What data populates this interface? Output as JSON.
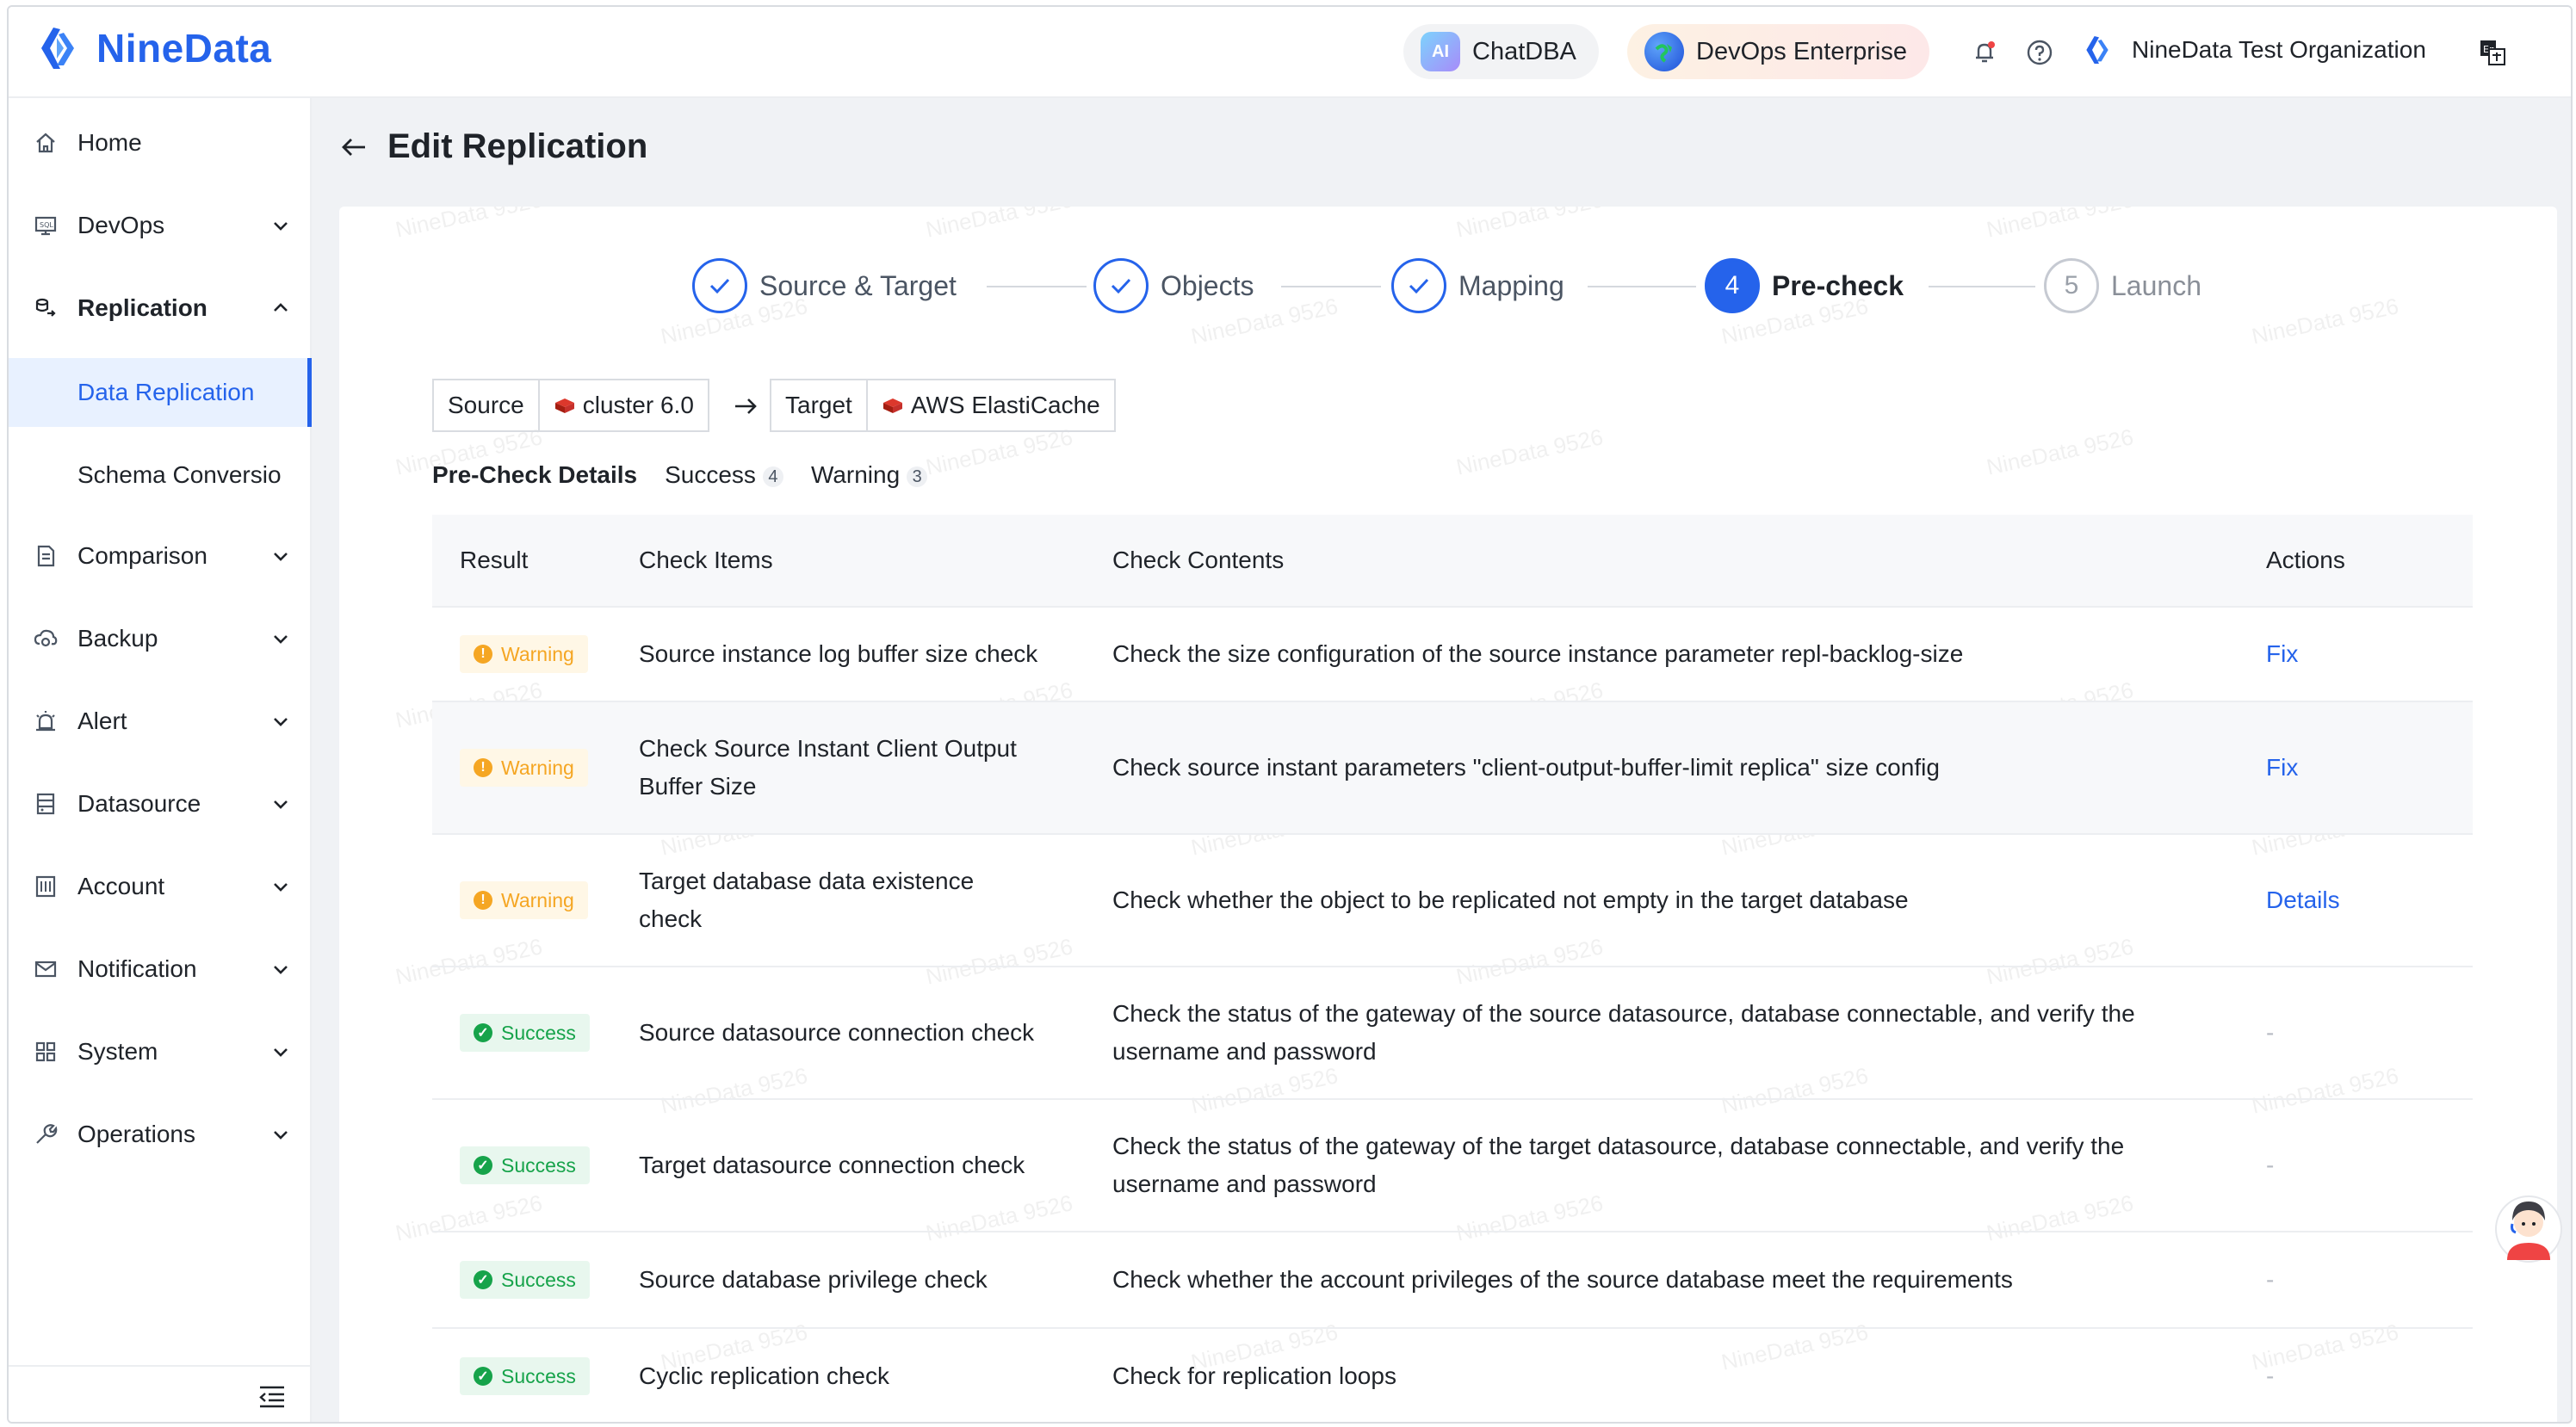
{
  "app": {
    "name": "NineData"
  },
  "header": {
    "chatdba_label": "ChatDBA",
    "chatdba_icon_text": "AI",
    "devops_label": "DevOps Enterprise",
    "org_name": "NineData Test Organization"
  },
  "sidebar": {
    "items": [
      {
        "label": "Home",
        "icon": "home-icon"
      },
      {
        "label": "DevOps",
        "icon": "devops-icon"
      },
      {
        "label": "Replication",
        "icon": "replication-icon"
      },
      {
        "label": "Data Replication"
      },
      {
        "label": "Schema Conversio"
      },
      {
        "label": "Comparison",
        "icon": "comparison-icon"
      },
      {
        "label": "Backup",
        "icon": "backup-icon"
      },
      {
        "label": "Alert",
        "icon": "alert-icon"
      },
      {
        "label": "Datasource",
        "icon": "datasource-icon"
      },
      {
        "label": "Account",
        "icon": "account-icon"
      },
      {
        "label": "Notification",
        "icon": "notification-icon"
      },
      {
        "label": "System",
        "icon": "system-icon"
      },
      {
        "label": "Operations",
        "icon": "operations-icon"
      }
    ]
  },
  "page": {
    "title": "Edit Replication"
  },
  "steps": [
    {
      "label": "Source & Target",
      "state": "done"
    },
    {
      "label": "Objects",
      "state": "done"
    },
    {
      "label": "Mapping",
      "state": "done"
    },
    {
      "label": "Pre-check",
      "number": "4",
      "state": "active"
    },
    {
      "label": "Launch",
      "number": "5",
      "state": "pending"
    }
  ],
  "source_target": {
    "source_label": "Source",
    "source_value": "cluster 6.0",
    "target_label": "Target",
    "target_value": "AWS ElastiCache"
  },
  "tabs": {
    "details": "Pre-Check Details",
    "success": "Success",
    "success_count": "4",
    "warning": "Warning",
    "warning_count": "3"
  },
  "table": {
    "headers": [
      "Result",
      "Check Items",
      "Check Contents",
      "Actions"
    ],
    "rows": [
      {
        "result": "Warning",
        "item": "Source instance log buffer size check",
        "content": "Check the size configuration of the source instance parameter repl-backlog-size",
        "action": "Fix"
      },
      {
        "result": "Warning",
        "item": "Check Source Instant Client Output Buffer Size",
        "content": "Check source instant parameters \"client-output-buffer-limit replica\" size config",
        "action": "Fix"
      },
      {
        "result": "Warning",
        "item": "Target database data existence check",
        "content": "Check whether the object to be replicated not empty in the target database",
        "action": "Details"
      },
      {
        "result": "Success",
        "item": "Source datasource connection check",
        "content": "Check the status of the gateway of the source datasource, database connectable, and verify the username and password",
        "action": "-"
      },
      {
        "result": "Success",
        "item": "Target datasource connection check",
        "content": "Check the status of the gateway of the target datasource, database connectable, and verify the username and password",
        "action": "-"
      },
      {
        "result": "Success",
        "item": "Source database privilege check",
        "content": "Check whether the account privileges of the source database meet the requirements",
        "action": "-"
      },
      {
        "result": "Success",
        "item": "Cyclic replication check",
        "content": "Check for replication loops",
        "action": "-"
      }
    ]
  },
  "watermark": "NineData 9526",
  "colors": {
    "accent": "#2563eb",
    "warning": "#f5a623",
    "success": "#16a34a"
  }
}
